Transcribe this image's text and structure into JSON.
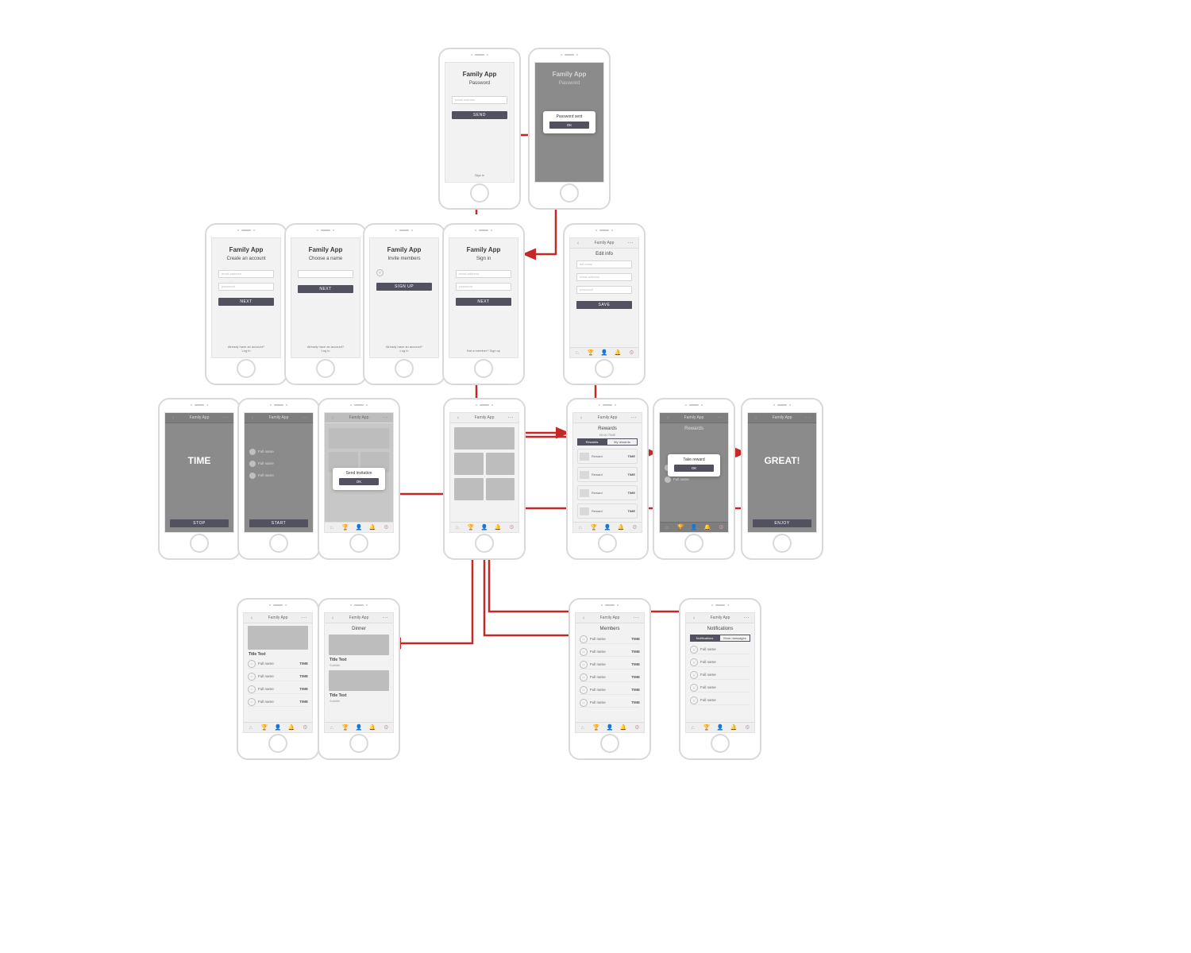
{
  "app_name": "Family App",
  "colors": {
    "accent": "#c62828",
    "button": "#51515f"
  },
  "row1": {
    "password": {
      "subtitle": "Password",
      "placeholder": "email address",
      "btn": "SEND",
      "footer": "Sign in"
    },
    "password_sent": {
      "subtitle": "Password",
      "modal_title": "Password sent",
      "modal_btn": "OK"
    }
  },
  "row2": {
    "create": {
      "subtitle": "Create an account",
      "field1": "email address",
      "field2": "password",
      "btn": "NEXT",
      "footer1": "Already have an account?",
      "footer2": "Log in"
    },
    "choose": {
      "subtitle": "Choose a name",
      "field1": "",
      "btn": "NEXT",
      "footer1": "Already have an account?",
      "footer2": "Log in"
    },
    "invite": {
      "subtitle": "Invite members",
      "btn": "SIGN UP",
      "footer1": "Already have an account?",
      "footer2": "Log in"
    },
    "signin": {
      "subtitle": "Sign in",
      "field1": "email address",
      "field2": "password",
      "btn": "NEXT",
      "footer": "Not a member? Sign up"
    },
    "editinfo": {
      "subtitle": "Edit info",
      "field1": "full name",
      "field2": "email address",
      "field3": "password",
      "btn": "SAVE"
    }
  },
  "row3": {
    "time": {
      "label": "TIME",
      "btn": "STOP"
    },
    "select": {
      "btn": "START",
      "opt1": "Full name",
      "opt2": "Full name",
      "opt3": "Full name"
    },
    "sendinv": {
      "modal_title": "Send invitation",
      "modal_btn": "OK"
    },
    "home": {
      "empty": ""
    },
    "rewards": {
      "title": "Rewards",
      "sub": "00:00 TIME",
      "tab1": "Rewards",
      "tab2": "My rewards",
      "item": "Reward",
      "badge": "TIME"
    },
    "takereward": {
      "title": "Rewards",
      "modal_title": "Take reward",
      "modal_btn": "OK",
      "item": "Full name"
    },
    "great": {
      "label": "GREAT!",
      "btn": "ENJOY"
    }
  },
  "row4": {
    "detail": {
      "title_text": "Title Text",
      "item": "Full name",
      "badge": "TIME"
    },
    "dinner": {
      "title": "Dinner",
      "title_text": "Title Text",
      "sub": "Subtitle"
    },
    "members": {
      "title": "Members",
      "item": "Full name",
      "badge": "TIME"
    },
    "notifications": {
      "title": "Notifications",
      "tab1": "Notifications",
      "tab2": "More messages",
      "item": "Full name"
    }
  },
  "nav_icons": {
    "home": "⌂",
    "trophy": "🏆",
    "user": "👤",
    "bell": "🔔",
    "gear": "⚙"
  }
}
